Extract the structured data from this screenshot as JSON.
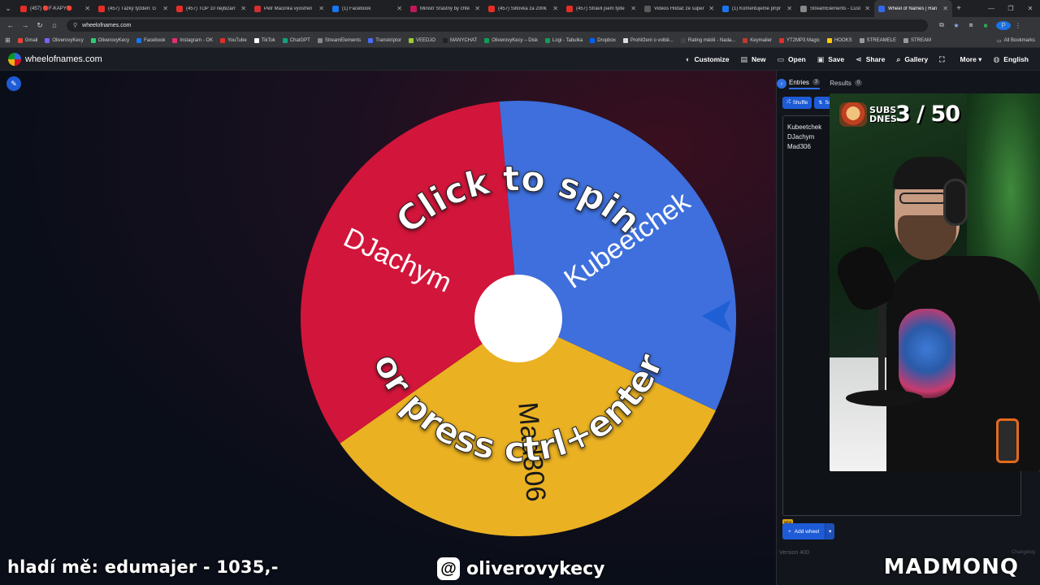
{
  "browser": {
    "tabs": [
      {
        "title": "(457) 🔴F-KAPY🔴",
        "color": "#e52d27"
      },
      {
        "title": "(457) Ťažký týždeň: G",
        "color": "#e52d27"
      },
      {
        "title": "(457) TOP 10 nejbizarr",
        "color": "#e52d27"
      },
      {
        "title": "Petr Macinka vyostřen",
        "color": "#d32f2f"
      },
      {
        "title": "(1) Facebook",
        "color": "#1877f2"
      },
      {
        "title": "Ministr Šťastný by chtě",
        "color": "#c2185b"
      },
      {
        "title": "(457) Šiltovka za 200€",
        "color": "#e52d27"
      },
      {
        "title": "(457) Strávil jsem týde",
        "color": "#e52d27"
      },
      {
        "title": "Videos Hlídač ze super",
        "color": "#5a5a5a"
      },
      {
        "title": "(1) Komentujeme přípr",
        "color": "#1877f2"
      },
      {
        "title": "StreamElements - Cust",
        "color": "#888888"
      },
      {
        "title": "Wheel of Names | Ran",
        "color": "#3369e8",
        "active": true
      }
    ],
    "url": "wheelofnames.com",
    "bookmarks": [
      {
        "label": "Gmail",
        "color": "#ea4335"
      },
      {
        "label": "OliverovyKecy",
        "color": "#7b61ff"
      },
      {
        "label": "OliverovyKecy",
        "color": "#2ecc71"
      },
      {
        "label": "Facebook",
        "color": "#1877f2"
      },
      {
        "label": "Instagram - OK",
        "color": "#e1306c"
      },
      {
        "label": "YouTube",
        "color": "#e52d27"
      },
      {
        "label": "TikTok",
        "color": "#ffffff"
      },
      {
        "label": "ChatGPT",
        "color": "#10a37f"
      },
      {
        "label": "StreamElements",
        "color": "#888888"
      },
      {
        "label": "Transkriptor",
        "color": "#4a6cf7"
      },
      {
        "label": "VEEDJO",
        "color": "#9acd32"
      },
      {
        "label": "MANYCHAT",
        "color": "#222222"
      },
      {
        "label": "OliverovyKecy – Disk",
        "color": "#0f9d58"
      },
      {
        "label": "Logi - Tabulka",
        "color": "#0f9d58"
      },
      {
        "label": "Dropbox",
        "color": "#0061ff"
      },
      {
        "label": "Prohlížení o volbě...",
        "color": "#dddddd"
      },
      {
        "label": "Rating médií - Nada...",
        "color": "#444444"
      },
      {
        "label": "Keymailer",
        "color": "#c0392b"
      },
      {
        "label": "YT2MP3 Magic",
        "color": "#e52d27"
      },
      {
        "label": "HOOKS",
        "color": "#ffcc00"
      },
      {
        "label": "STREAMELE",
        "color": "#999999"
      },
      {
        "label": "STREAM",
        "color": "#999999"
      }
    ],
    "all_bookmarks": "All Bookmarks",
    "profile_initial": "P"
  },
  "app": {
    "site_name": "wheelofnames.com",
    "nav": [
      {
        "label": "Customize",
        "icon": "palette-icon",
        "glyph": "◐"
      },
      {
        "label": "New",
        "icon": "new-file-icon",
        "glyph": "▤"
      },
      {
        "label": "Open",
        "icon": "folder-icon",
        "glyph": "▭"
      },
      {
        "label": "Save",
        "icon": "save-icon",
        "glyph": "▣"
      },
      {
        "label": "Share",
        "icon": "share-icon",
        "glyph": "⋖"
      },
      {
        "label": "Gallery",
        "icon": "search-icon",
        "glyph": "⌕"
      },
      {
        "label": "",
        "icon": "fullscreen-icon",
        "glyph": "⛶"
      },
      {
        "label": "More ▾",
        "icon": "more-icon",
        "glyph": ""
      },
      {
        "label": "English",
        "icon": "globe-icon",
        "glyph": "◍"
      }
    ]
  },
  "wheel": {
    "center_color": "#ffffff",
    "pointer_color": "#1f5fd6",
    "prompt_top": "Click to spin",
    "prompt_bottom": "or press ctrl+enter",
    "segments": [
      {
        "label": "Kubeetchek",
        "color": "#3e6fdc"
      },
      {
        "label": "Mad306",
        "color": "#eab122"
      },
      {
        "label": "DJachym",
        "color": "#d2153a"
      }
    ]
  },
  "sidebar": {
    "tab_entries": "Entries",
    "entries_count": "3",
    "tab_results": "Results",
    "results_count": "0",
    "shuffle_label": "Shuffle",
    "sort_label": "Sort",
    "entries": [
      "Kubeetchek",
      "DJachym",
      "Mad306"
    ],
    "new_badge": "NEW",
    "add_wheel_label": "Add wheel",
    "version": "Version 400",
    "changelog": "Changelog"
  },
  "overlay": {
    "subs_label": "SUBS DNES",
    "subs_count": "3 / 50",
    "ticker_left": "hladí mě: edumajer - 1035,-",
    "ticker_mid": "oliverovykecy",
    "ticker_right": "MADMONQ"
  }
}
